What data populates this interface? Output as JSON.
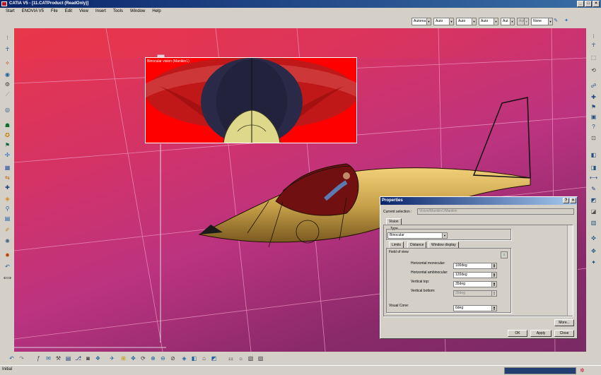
{
  "window": {
    "title": "CATIA V5 - [11.CATProduct (ReadOnly)]",
    "controls": [
      "_",
      "□",
      "×"
    ]
  },
  "menubar": [
    "Start",
    "ENOVIA V5",
    "File",
    "Edit",
    "View",
    "Insert",
    "Tools",
    "Window",
    "Help"
  ],
  "toolbar_combos": [
    "Automa",
    "Auto",
    "Auto",
    "Auto",
    "Aut",
    "Aut",
    "None"
  ],
  "binocular": {
    "title": "Binocular vision (Manikin1)"
  },
  "properties": {
    "title": "Properties",
    "current_selection_label": "Current selection :",
    "current_selection_value": "Vision/Manikin1/Manikin",
    "tab": "Vision",
    "type_label": "Type",
    "type_value": "Binocular",
    "subtabs": [
      "Limits",
      "Distance",
      "Window display"
    ],
    "field_of_view_label": "Field of view",
    "fields": [
      {
        "label": "Horizontal monocular:",
        "value": "100deg",
        "disabled": false
      },
      {
        "label": "Horizontal ambinocular:",
        "value": "120deg",
        "disabled": false
      },
      {
        "label": "Vertical top:",
        "value": "35deg",
        "disabled": false
      },
      {
        "label": "Vertical bottom:",
        "value": "35deg",
        "disabled": true
      }
    ],
    "visual_cone_label": "Visual Cone:",
    "visual_cone_value": "6deg",
    "more_button": "More...",
    "ok_button": "OK",
    "apply_button": "Apply",
    "close_button": "Close"
  },
  "status": {
    "text": "Initial"
  },
  "colors": {
    "title_bar": "#0a246a",
    "viewport_top": "#e8364a",
    "viewport_bottom": "#7a2a66",
    "binocular_bg": "#ff0000",
    "fuselage": "#c9a24a"
  }
}
